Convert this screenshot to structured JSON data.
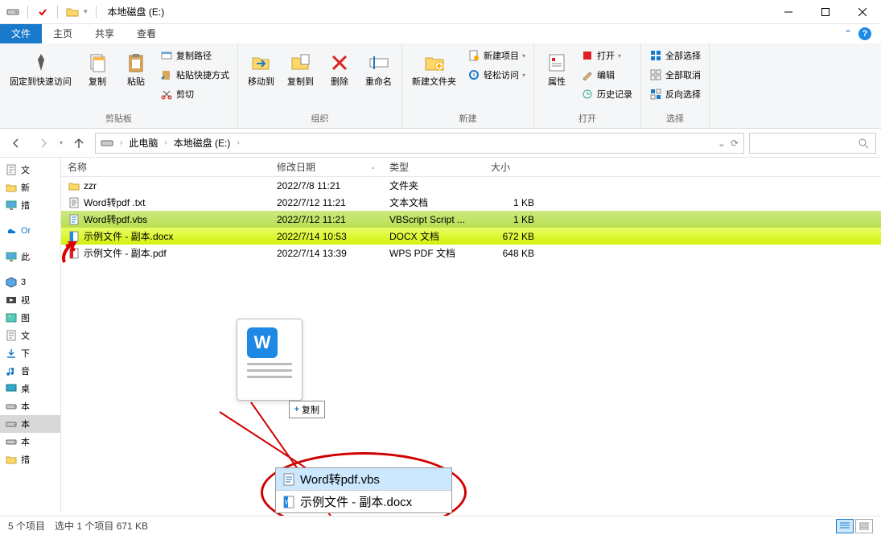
{
  "title": "本地磁盘 (E:)",
  "tabs": {
    "file": "文件",
    "home": "主页",
    "share": "共享",
    "view": "查看"
  },
  "ribbon": {
    "pin": "固定到快速访问",
    "copy": "复制",
    "paste": "粘贴",
    "copy_path": "复制路径",
    "paste_shortcut": "粘贴快捷方式",
    "cut": "剪切",
    "group_clipboard": "剪贴板",
    "move_to": "移动到",
    "copy_to": "复制到",
    "delete": "删除",
    "rename": "重命名",
    "group_organize": "组织",
    "new_folder": "新建文件夹",
    "new_item": "新建项目",
    "easy_access": "轻松访问",
    "group_new": "新建",
    "properties": "属性",
    "open": "打开",
    "edit": "编辑",
    "history": "历史记录",
    "group_open": "打开",
    "select_all": "全部选择",
    "select_none": "全部取消",
    "invert_selection": "反向选择",
    "group_select": "选择"
  },
  "breadcrumbs": {
    "this_pc": "此电脑",
    "drive": "本地磁盘 (E:)"
  },
  "sidebar": [
    {
      "icon": "doc",
      "label": "文"
    },
    {
      "icon": "folder",
      "label": "新"
    },
    {
      "icon": "pc",
      "label": "措"
    },
    {
      "icon": "onedrive",
      "label": "Or",
      "color": "#0a7bd6"
    },
    {
      "icon": "pc",
      "label": "此"
    },
    {
      "icon": "cube",
      "label": "3"
    },
    {
      "icon": "video",
      "label": "视"
    },
    {
      "icon": "image",
      "label": "图"
    },
    {
      "icon": "doc",
      "label": "文"
    },
    {
      "icon": "download",
      "label": "下"
    },
    {
      "icon": "music",
      "label": "音"
    },
    {
      "icon": "desktop",
      "label": "桌"
    },
    {
      "icon": "disk",
      "label": "本"
    },
    {
      "icon": "disk",
      "label": "本",
      "sel": true
    },
    {
      "icon": "disk",
      "label": "本"
    },
    {
      "icon": "folder",
      "label": "措"
    }
  ],
  "columns": {
    "name": "名称",
    "date": "修改日期",
    "type": "类型",
    "size": "大小"
  },
  "rows": [
    {
      "icon": "folder",
      "name": "zzr",
      "date": "2022/7/8 11:21",
      "type": "文件夹",
      "size": ""
    },
    {
      "icon": "txt",
      "name": "Word转pdf .txt",
      "date": "2022/7/12 11:21",
      "type": "文本文档",
      "size": "1 KB"
    },
    {
      "icon": "vbs",
      "name": "Word转pdf.vbs",
      "date": "2022/7/12 11:21",
      "type": "VBScript Script ...",
      "size": "1 KB",
      "highlight": true,
      "selected": true
    },
    {
      "icon": "docx",
      "name": "示例文件 - 副本.docx",
      "date": "2022/7/14 10:53",
      "type": "DOCX 文档",
      "size": "672 KB",
      "highlight": true
    },
    {
      "icon": "pdf",
      "name": "示例文件 - 副本.pdf",
      "date": "2022/7/14 13:39",
      "type": "WPS PDF 文档",
      "size": "648 KB"
    }
  ],
  "drag_badge": "复制",
  "callout": {
    "r1": "Word转pdf.vbs",
    "r2": "示例文件 - 副本.docx"
  },
  "status": {
    "count": "5 个项目",
    "selected": "选中 1 个项目  671 KB"
  }
}
